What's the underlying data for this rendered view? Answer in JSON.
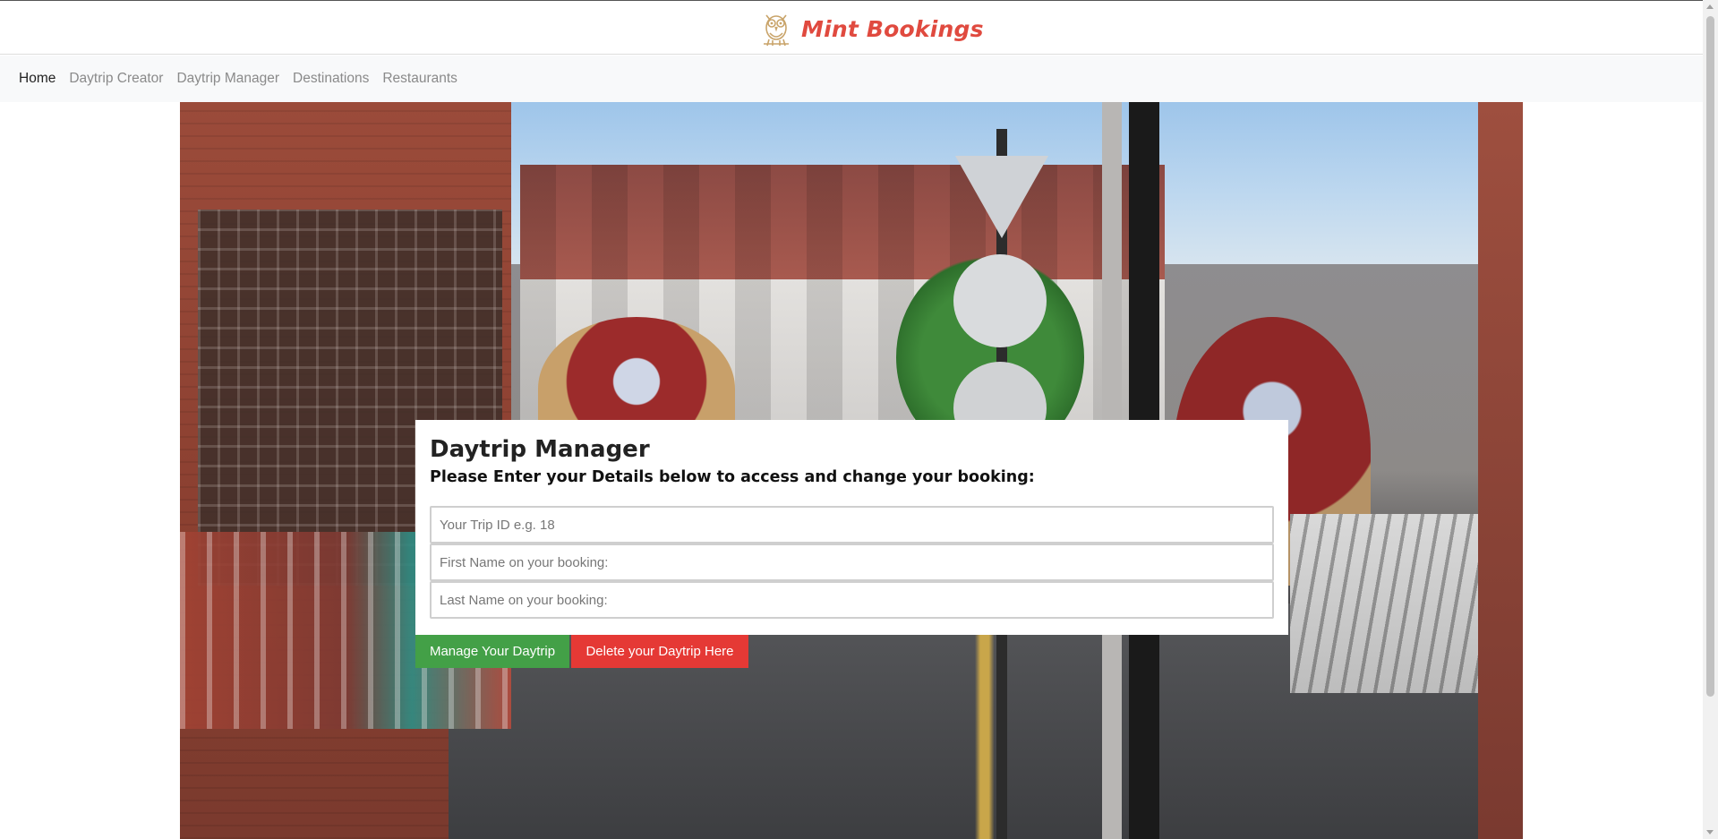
{
  "header": {
    "brand_name": "Mint Bookings",
    "logo_icon": "owl-icon",
    "brand_color": "#e04a3f"
  },
  "nav": {
    "items": [
      {
        "label": "Home",
        "active": true
      },
      {
        "label": "Daytrip Creator",
        "active": false
      },
      {
        "label": "Daytrip Manager",
        "active": false
      },
      {
        "label": "Destinations",
        "active": false
      },
      {
        "label": "Restaurants",
        "active": false
      }
    ]
  },
  "form": {
    "title": "Daytrip Manager",
    "subtitle": "Please Enter your Details below to access and change your booking:",
    "trip_id_placeholder": "Your Trip ID e.g. 18",
    "first_name_placeholder": "First Name on your booking:",
    "last_name_placeholder": "Last Name on your booking:",
    "trip_id_value": "",
    "first_name_value": "",
    "last_name_value": ""
  },
  "actions": {
    "manage_label": "Manage Your Daytrip",
    "delete_label": "Delete your Daytrip Here",
    "manage_color": "#43a047",
    "delete_color": "#e53935"
  }
}
